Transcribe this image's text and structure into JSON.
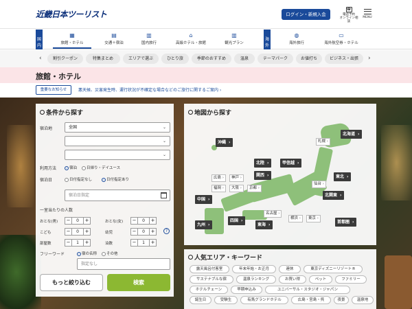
{
  "header": {
    "logo_text": "近畿日本ツーリスト",
    "login_label": "ログイン・新規入会",
    "phone_label": "電話予約\nオンライン相談",
    "menu_label": "MENU"
  },
  "nav": {
    "domestic_tag": "国内",
    "overseas_tag": "海外",
    "items": [
      {
        "label": "旅館・ホテル",
        "icon": "hotel-icon"
      },
      {
        "label": "交通＋宿泊",
        "icon": "train-icon"
      },
      {
        "label": "国内旅行",
        "icon": "map-icon"
      },
      {
        "label": "高級ホテル・旅館",
        "icon": "luxury-icon"
      },
      {
        "label": "観光プラン",
        "icon": "building-icon"
      },
      {
        "label": "海外旅行",
        "icon": "globe-icon"
      },
      {
        "label": "海外航空券・ホテル",
        "icon": "plane-icon"
      }
    ]
  },
  "chips": [
    "割引クーポン",
    "特集まとめ",
    "エリアで選ぶ",
    "ひとり旅",
    "季節のおすすめ",
    "温泉",
    "テーマパーク",
    "お値打ち",
    "ビジネス・出張"
  ],
  "page": {
    "title": "旅館・ホテル",
    "notice_button": "重要なお知らせ",
    "notice_text": "悪天候、災害発生時、運行状況が不確定な場合などのご旅行に関するご案内 ›"
  },
  "search_panel": {
    "title": "条件から探す",
    "lodging_label": "宿泊地",
    "area_select": "全国",
    "pref_select": "",
    "city_select": "",
    "usage_label": "利用方法",
    "usage_options": [
      "宿泊",
      "日帰り・デイユース"
    ],
    "date_label": "宿泊日",
    "date_options": [
      "日付指定なし",
      "日付指定あり"
    ],
    "date_placeholder": "宿泊日指定",
    "per_room_title": "一室当たりの人数",
    "adult_male_label": "おとな(男)",
    "adult_female_label": "おとな(女)",
    "child_label": "こども",
    "infant_label": "幼児",
    "rooms_label": "部屋数",
    "nights_label": "泊数",
    "adult_male_value": "0",
    "adult_female_value": "0",
    "child_value": "0",
    "infant_value": "0",
    "rooms_value": "1",
    "nights_value": "1",
    "help_glyph": "?",
    "freeword_label": "フリーワード",
    "freeword_options": [
      "宿の名称",
      "その他"
    ],
    "freeword_placeholder": "指定なし",
    "narrow_button": "もっと絞り込む",
    "search_button": "検索"
  },
  "map_panel": {
    "title": "地図から探す",
    "regions": [
      "沖縄",
      "北海道",
      "北陸",
      "甲信越",
      "関西",
      "東北",
      "中国",
      "北関東",
      "九州",
      "四国",
      "東海",
      "首都圏"
    ],
    "prefs": [
      "札幌",
      "広島",
      "神戸",
      "福岡",
      "大阪",
      "京都",
      "仙台",
      "名古屋",
      "横浜",
      "東京"
    ]
  },
  "keyword_panel": {
    "title": "人気エリア・キーワード",
    "tags": [
      "露天風呂付客室",
      "年末年始・お正月",
      "連休",
      "東京ディズニーリゾート®",
      "サステナブルな宿",
      "温泉ランキング",
      "お買い得",
      "ペット",
      "ファミリー",
      "ホテルチェーン",
      "早期申込み",
      "ユニバーサル・スタジオ・ジャパン",
      "誕生日",
      "受験生",
      "有馬グランドホテル",
      "広島・宮島・呉",
      "夜景",
      "温泉地"
    ]
  },
  "colors": {
    "brand": "#1a4a9a",
    "search_button": "#8cb832",
    "pink_band": "#fbe4e7"
  }
}
